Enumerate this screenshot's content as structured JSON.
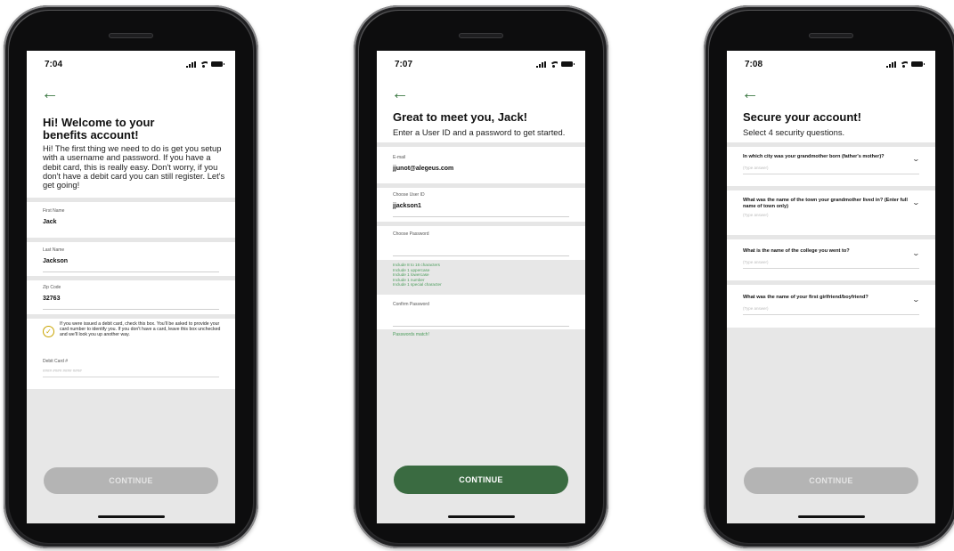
{
  "screens": [
    {
      "time": "7:04",
      "title_line1": "Hi! Welcome to your",
      "title_line2": "benefits account!",
      "intro": "Hi! The first thing we need to do is get you setup with a username and password. If you have a debit card, this is really easy. Don't worry, if you don't have a debit card you can still register. Let's get going!",
      "fields": [
        {
          "label": "First Name",
          "value": "Jack"
        },
        {
          "label": "Last Name",
          "value": "Jackson"
        },
        {
          "label": "Zip Code",
          "value": "32763"
        }
      ],
      "checkbox_text": "If you were issued a debit card, check this box. You'll be asked to provide your card number to identify you. If you don't have a card, leave this box unchecked and we'll look you up another way.",
      "debit_label": "Debit Card #",
      "debit_placeholder": "#### #### #### ####",
      "continue_label": "CONTINUE"
    },
    {
      "time": "7:07",
      "title": "Great to meet you, Jack!",
      "subtitle": "Enter a User ID and a password to get started.",
      "fields": [
        {
          "label": "E-mail",
          "value": "jjunot@alegeus.com"
        },
        {
          "label": "Choose User ID",
          "value": "jjackson1"
        },
        {
          "label": "Choose Password",
          "value": ""
        }
      ],
      "requirements": [
        "Include 8 to 16 characters",
        "Include 1 uppercase",
        "Include 1 lowercase",
        "Include 1 number",
        "Include 1 special character"
      ],
      "confirm_label": "Confirm Password",
      "match_text": "Passwords match!",
      "continue_label": "CONTINUE"
    },
    {
      "time": "7:08",
      "title": "Secure your account!",
      "subtitle": "Select 4 security questions.",
      "questions": [
        {
          "text": "In which city was your grandmother born (father's mother)?",
          "placeholder": "(Type answer)"
        },
        {
          "text": "What was the name of the town your grandmother lived in? (Enter full name of town only)",
          "placeholder": "(Type answer)"
        },
        {
          "text": "What is the name of the college you went to?",
          "placeholder": "(Type answer)"
        },
        {
          "text": "What was the name of your first girlfriend/boyfriend?",
          "placeholder": "(Type answer)"
        }
      ],
      "continue_label": "CONTINUE"
    }
  ],
  "colors": {
    "accent_green": "#3a6b41",
    "hint_green": "#4a9c5a",
    "disabled_button": "#b4b4b4",
    "check_gold": "#c9a400"
  },
  "icons": [
    "back-arrow-icon",
    "signal-icon",
    "wifi-icon",
    "battery-icon",
    "check-icon",
    "chevron-down-icon"
  ]
}
